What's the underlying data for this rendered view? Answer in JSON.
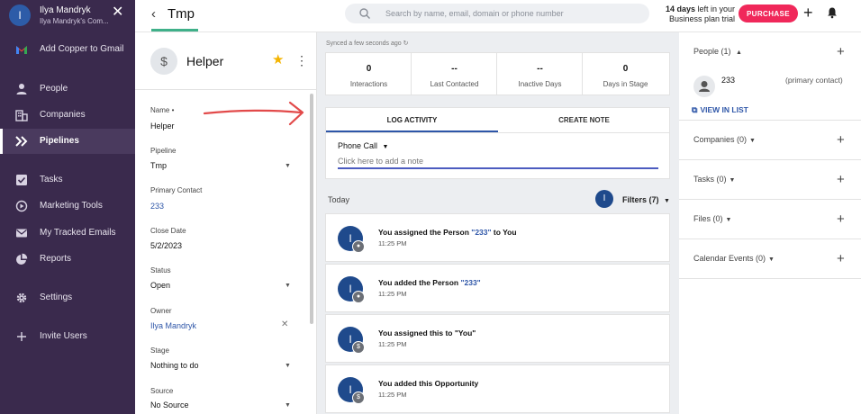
{
  "sidebar": {
    "user_initial": "I",
    "user_name": "Ilya Mandryk",
    "user_company": "Ilya Mandryk's Com...",
    "items": [
      {
        "label": "Add Copper to Gmail",
        "icon": "gmail-icon"
      },
      {
        "label": "People",
        "icon": "person-icon"
      },
      {
        "label": "Companies",
        "icon": "building-icon"
      },
      {
        "label": "Pipelines",
        "icon": "pipeline-icon",
        "active": true
      },
      {
        "label": "Tasks",
        "icon": "checkbox-icon"
      },
      {
        "label": "Marketing Tools",
        "icon": "marketing-icon"
      },
      {
        "label": "My Tracked Emails",
        "icon": "mail-icon"
      },
      {
        "label": "Reports",
        "icon": "pie-chart-icon"
      },
      {
        "label": "Settings",
        "icon": "gear-icon"
      },
      {
        "label": "Invite Users",
        "icon": "plus-icon"
      }
    ]
  },
  "topbar": {
    "title": "Tmp",
    "search_placeholder": "Search by name, email, domain or phone number",
    "trial_days": "14 days",
    "trial_text": " left in your",
    "trial_line2": "Business plan trial",
    "purchase_label": "PURCHASE"
  },
  "opportunity": {
    "avatar_symbol": "$",
    "name": "Helper",
    "fields": [
      {
        "label": "Name •",
        "value": "Helper"
      },
      {
        "label": "Pipeline",
        "value": "Tmp"
      },
      {
        "label": "Primary Contact",
        "value": "233"
      },
      {
        "label": "Close Date",
        "value": "5/2/2023"
      },
      {
        "label": "Status",
        "value": "Open"
      },
      {
        "label": "Owner",
        "value": "Ilya Mandryk"
      },
      {
        "label": "Stage",
        "value": "Nothing to do"
      },
      {
        "label": "Source",
        "value": "No Source"
      }
    ]
  },
  "center": {
    "synced_text": "Synced a few seconds ago ↻",
    "stats": [
      {
        "value": "0",
        "label": "Interactions"
      },
      {
        "value": "--",
        "label": "Last Contacted"
      },
      {
        "value": "--",
        "label": "Inactive Days"
      },
      {
        "value": "0",
        "label": "Days in Stage"
      }
    ],
    "tabs": {
      "log_activity": "LOG ACTIVITY",
      "create_note": "CREATE NOTE"
    },
    "activity_type": "Phone Call",
    "note_placeholder": "Click here to add a note",
    "today_label": "Today",
    "filter_avatar_initial": "I",
    "filters_label": "Filters (7)",
    "feed": [
      {
        "pre": "You assigned the Person ",
        "hl": "\"233\"",
        "post": " to You",
        "time": "11:25 PM",
        "badge": "person"
      },
      {
        "pre": "You added the Person ",
        "hl": "\"233\"",
        "post": "",
        "time": "11:25 PM",
        "badge": "person"
      },
      {
        "pre": "You assigned this to \"You\"",
        "hl": "",
        "post": "",
        "time": "11:25 PM",
        "badge": "dollar"
      },
      {
        "pre": "You added this Opportunity",
        "hl": "",
        "post": "",
        "time": "11:25 PM",
        "badge": "dollar"
      }
    ],
    "feed_avatar_initial": "I"
  },
  "right": {
    "people_title": "People (1)",
    "person_name": "233",
    "person_role": "(primary contact)",
    "view_in_list": "VIEW IN LIST",
    "companies_title": "Companies (0)",
    "tasks_title": "Tasks (0)",
    "files_title": "Files (0)",
    "calendar_title": "Calendar Events (0)"
  },
  "colors": {
    "sidebar_bg": "#3a2a4d",
    "accent_blue": "#2e56a8",
    "purchase_pink": "#f0285a",
    "annotation_red": "#e24a4a"
  }
}
